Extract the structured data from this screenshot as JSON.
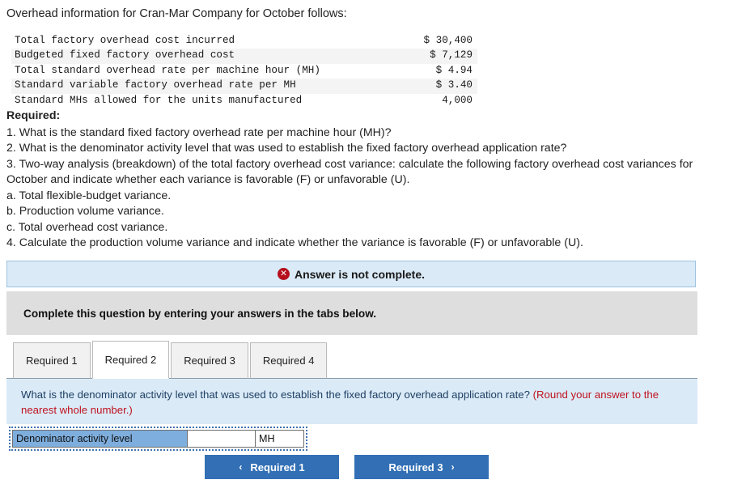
{
  "intro": "Overhead information for Cran-Mar Company for October follows:",
  "facts": {
    "rows": [
      {
        "label": "Total factory overhead cost incurred",
        "value": "$ 30,400"
      },
      {
        "label": "Budgeted fixed factory overhead cost",
        "value": "$ 7,129"
      },
      {
        "label": "Total standard overhead rate per machine hour (MH)",
        "value": "$ 4.94"
      },
      {
        "label": "Standard variable factory overhead rate per MH",
        "value": "$ 3.40"
      },
      {
        "label": "Standard MHs allowed for the units manufactured",
        "value": "4,000"
      }
    ]
  },
  "required": {
    "title": "Required:",
    "lines": [
      "1. What is the standard fixed factory overhead rate per machine hour (MH)?",
      "2. What is the denominator activity level that was used to establish the fixed factory overhead application rate?",
      "3. Two-way analysis (breakdown) of the total factory overhead cost variance: calculate the following factory overhead cost variances for October and indicate whether each variance is favorable (F) or unfavorable (U).",
      "a. Total flexible-budget variance.",
      "b. Production volume variance.",
      "c. Total overhead cost variance.",
      "4. Calculate the production volume variance and indicate whether the variance is favorable (F) or unfavorable (U)."
    ]
  },
  "notice": {
    "icon": "error-circle-x-icon",
    "icon_glyph": "✕",
    "text": "Answer is not complete.",
    "background": "#daeaf7",
    "border": "#9dc3e0",
    "icon_color": "#b50f1c"
  },
  "instruction": {
    "text": "Complete this question by entering your answers in the tabs below.",
    "background": "#dedede"
  },
  "tabs": {
    "active_index": 1,
    "items": [
      {
        "label": "Required 1"
      },
      {
        "label": "Required 2"
      },
      {
        "label": "Required 3"
      },
      {
        "label": "Required 4"
      }
    ]
  },
  "question": {
    "main": "What is the denominator activity level that was used to establish the fixed factory overhead application rate?",
    "hint": "(Round your answer to the nearest whole number.)",
    "hint_color": "#c0121f",
    "background": "#daeaf7"
  },
  "answer_table": {
    "label": "Denominator activity level",
    "value": "",
    "placeholder": "",
    "unit": "MH",
    "label_background": "#7eaedd",
    "selection_border": "#3f72b0"
  },
  "nav": {
    "prev": {
      "label": "Required 1",
      "chevron": "‹"
    },
    "next": {
      "label": "Required 3",
      "chevron": "›"
    },
    "color": "#326fb5"
  }
}
